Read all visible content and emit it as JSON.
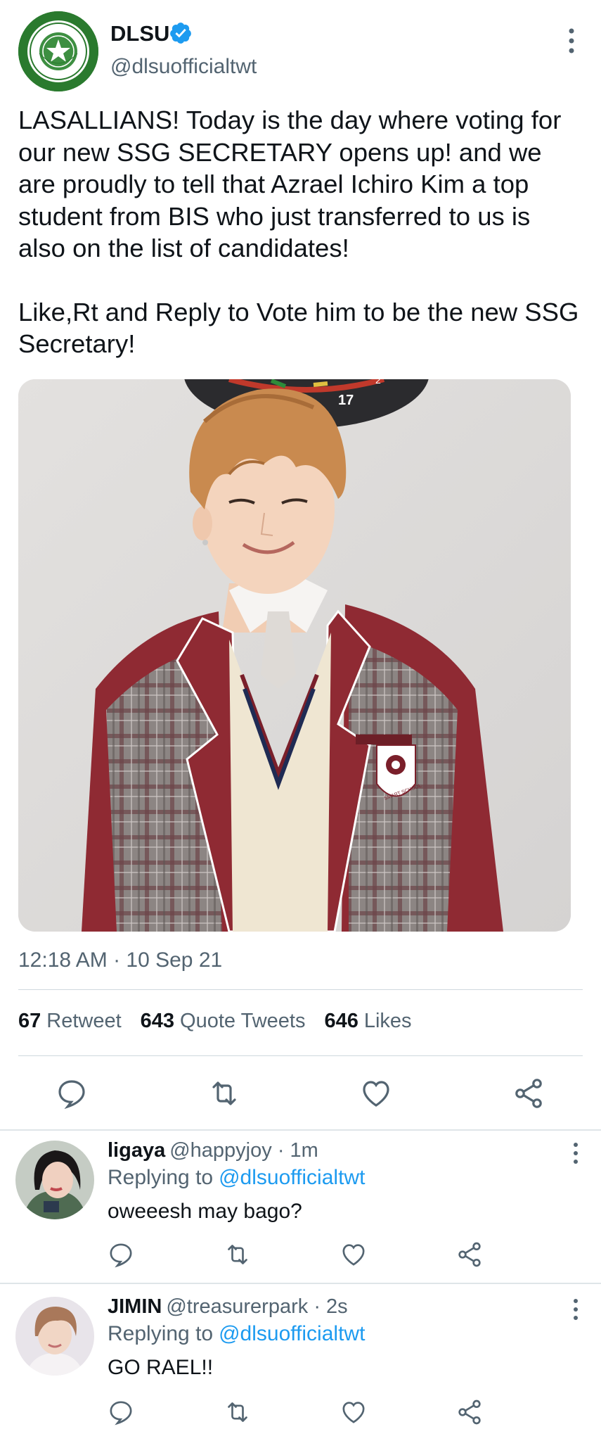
{
  "tweet": {
    "author": {
      "name": "DLSU",
      "handle": "@dlsuofficialtwt",
      "logo_text": "DE LA SALLE UNIVERSITY MANILA",
      "brand_color": "#2a7a2e"
    },
    "text_paragraphs": [
      "LASALLIANS! Today is the day where voting for our new SSG SECRETARY opens up! and we are proudly to tell that Azrael Ichiro Kim a top student from BIS who just transferred to us is also on the list of candidates!",
      "Like,Rt and Reply to Vote him to be the new SSG Secretary!"
    ],
    "media": {
      "dartboard_number": "17",
      "badge_text": "SMART SCHOOL"
    },
    "timestamp": "12:18 AM · 10 Sep 21",
    "stats": {
      "retweets_count": "67",
      "retweets_label": "Retweet",
      "quotes_count": "643",
      "quotes_label": "Quote Tweets",
      "likes_count": "646",
      "likes_label": "Likes"
    },
    "actions": [
      "reply-icon",
      "retweet-icon",
      "like-icon",
      "share-icon"
    ]
  },
  "replies": [
    {
      "name": "ligaya",
      "handle": "@happyjoy",
      "time": "· 1m",
      "replying_prefix": "Replying to",
      "replying_to": "@dlsuofficialtwt",
      "text": "oweeesh may bago?"
    },
    {
      "name": "JIMIN",
      "handle": "@treasurerpark",
      "time": "· 2s",
      "replying_prefix": "Replying to",
      "replying_to": "@dlsuofficialtwt",
      "text": "GO RAEL!!"
    }
  ],
  "colors": {
    "text": "#0f1419",
    "secondary": "#536471",
    "link": "#1d9bf0",
    "verified": "#1d9bf0"
  }
}
